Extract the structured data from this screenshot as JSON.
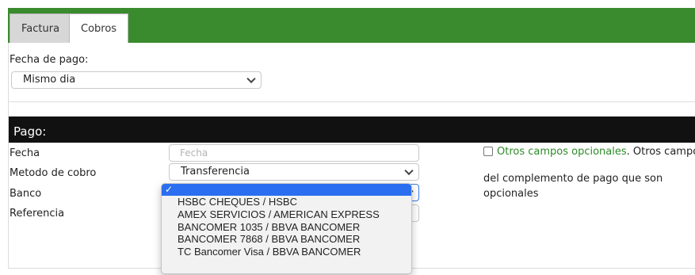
{
  "tabs": [
    {
      "label": "Factura",
      "active": false
    },
    {
      "label": "Cobros",
      "active": true
    }
  ],
  "fecha_pago": {
    "label": "Fecha de pago:",
    "selected": "Mismo dia"
  },
  "pago": {
    "title": "Pago:",
    "fields": {
      "fecha_label": "Fecha",
      "fecha_placeholder": "Fecha",
      "metodo_label": "Metodo de cobro",
      "metodo_selected": "Transferencia",
      "banco_label": "Banco",
      "referencia_label": "Referencia"
    },
    "optional": {
      "link_text": "Otros campos opcionales",
      "rest_line1": ". Otros campos",
      "line2": "del complemento de pago que son",
      "line3": "opcionales"
    }
  },
  "banco_dropdown": {
    "selected_mark": "✓",
    "options": [
      "HSBC CHEQUES / HSBC",
      "AMEX SERVICIOS / AMERICAN EXPRESS",
      "BANCOMER 1035 / BBVA BANCOMER",
      "BANCOMER 7868 / BBVA BANCOMER",
      "TC Bancomer Visa / BBVA BANCOMER"
    ]
  },
  "colors": {
    "header_green": "#3a8a2e",
    "pago_bar": "#111111",
    "link_green": "#2f8a2a",
    "dropdown_highlight": "#2b6ff0"
  }
}
